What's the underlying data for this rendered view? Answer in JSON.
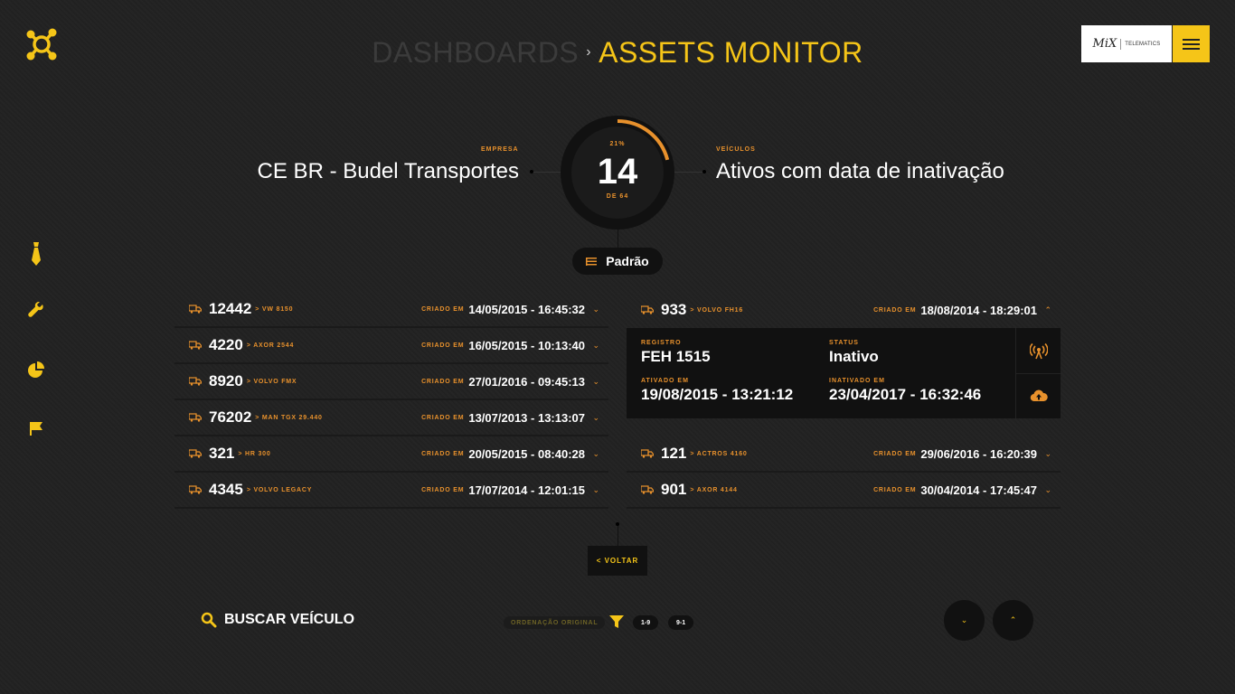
{
  "header": {
    "breadcrumb_parent": "DASHBOARDS",
    "breadcrumb_sep": "›",
    "title": "ASSETS MONITOR",
    "brand_mix": "MiX",
    "brand_telematics": "TELEMATICS"
  },
  "summary": {
    "company_label": "EMPRESA",
    "company_name": "CE BR - Budel Transportes",
    "vehicles_label": "VEÍCULOS",
    "vehicles_desc": "Ativos com data de inativação",
    "gauge_percent_label": "21%",
    "gauge_fraction": 0.21,
    "gauge_value": "14",
    "gauge_total": "DE 64",
    "preset_label": "Padrão"
  },
  "vehicles": {
    "created_label": "CRIADO EM",
    "left": [
      {
        "num": "12442",
        "model": "> VW 8150",
        "date": "14/05/2015 - 16:45:32"
      },
      {
        "num": "4220",
        "model": "> AXOR 2544",
        "date": "16/05/2015 - 10:13:40"
      },
      {
        "num": "8920",
        "model": "> VOLVO FMX",
        "date": "27/01/2016 - 09:45:13"
      },
      {
        "num": "76202",
        "model": "> MAN TGX 29.440",
        "date": "13/07/2013 - 13:13:07"
      },
      {
        "num": "321",
        "model": "> HR 300",
        "date": "20/05/2015 - 08:40:28"
      },
      {
        "num": "4345",
        "model": "> VOLVO LEGACY",
        "date": "17/07/2014 - 12:01:15"
      }
    ],
    "right_expanded": {
      "num": "933",
      "model": "> VOLVO FH16",
      "date": "18/08/2014 - 18:29:01"
    },
    "detail": {
      "registro_label": "REGISTRO",
      "registro": "FEH 1515",
      "status_label": "STATUS",
      "status": "Inativo",
      "ativado_label": "ATIVADO EM",
      "ativado": "19/08/2015 - 13:21:12",
      "inativado_label": "INATIVADO EM",
      "inativado": "23/04/2017 - 16:32:46"
    },
    "right": [
      {
        "num": "121",
        "model": "> ACTROS 4160",
        "date": "29/06/2016 - 16:20:39"
      },
      {
        "num": "901",
        "model": "> AXOR 4144",
        "date": "30/04/2014 - 17:45:47"
      }
    ]
  },
  "footer": {
    "back_label": "< VOLTAR",
    "search_label": "BUSCAR VEÍCULO",
    "sort_label": "ORDENAÇÃO ORIGINAL",
    "sort_asc": "1-9",
    "sort_desc": "9-1",
    "scroll_down": "⌄",
    "scroll_up": "⌃"
  },
  "colors": {
    "accent": "#f5c518",
    "orange": "#e8912c",
    "background": "#222222"
  },
  "icons": [
    "app-logo-icon",
    "tie-icon",
    "wrench-icon",
    "pie-chart-icon",
    "flag-icon",
    "truck-icon",
    "antenna-icon",
    "cloud-upload-icon",
    "search-icon",
    "filter-icon",
    "menu-icon"
  ]
}
